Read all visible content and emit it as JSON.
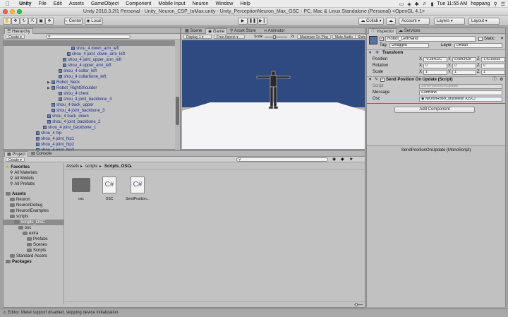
{
  "menubar": {
    "app_name": "Unity",
    "items": [
      "File",
      "Edit",
      "Assets",
      "GameObject",
      "Component",
      "Mobile Input",
      "Neuron",
      "Window",
      "Help"
    ],
    "clock": "Tue 11:55 AM",
    "user": "hoppang"
  },
  "window": {
    "title": "Unity 2018.3.2f1 Personal - Unity_Neuron_CSP_toMax.unity - Unity_PerceptionNeuron_Max_OSC - PC, Mac & Linux Standalone (Personal) <OpenGL 4.1>"
  },
  "toolbar": {
    "pivot_label": "Center",
    "space_label": "Local",
    "collab_label": "Collab",
    "account_label": "Account",
    "layers_label": "Layers",
    "layout_label": "Layout"
  },
  "hierarchy": {
    "tab_label": "Hierarchy",
    "create_label": "Create",
    "items": [
      {
        "label": "shou_4 down_arm_left"
      },
      {
        "label": "shou_4 joint_down_arm_left"
      },
      {
        "label": "shou_4 joint_upper_arm_left"
      },
      {
        "label": "shou_4 upper_arm_left"
      },
      {
        "label": "shou_4 collar_left"
      },
      {
        "label": "shou_4 collarbone_left"
      },
      {
        "label": "Robot_Neck"
      },
      {
        "label": "Robot_RightShoulder"
      },
      {
        "label": "shou_4 chest"
      },
      {
        "label": "shou_4 joint_backbone_4"
      },
      {
        "label": "shou_4 back_upper"
      },
      {
        "label": "shou_4 joint_backbone_3"
      },
      {
        "label": "shou_4 back_down"
      },
      {
        "label": "shou_4 joint_backbone_2"
      },
      {
        "label": "shou_4 joint_backbone_1"
      },
      {
        "label": "shou_4 hip"
      },
      {
        "label": "shou_4 joint_hip1"
      },
      {
        "label": "shou_4 joint_hip2"
      },
      {
        "label": "shou_4 joint_hip3"
      }
    ]
  },
  "scene_view": {
    "tabs": [
      "Scene",
      "Game",
      "Asset Store",
      "Animator"
    ],
    "display_label": "Display 1",
    "aspect_label": "Free Aspect",
    "scale_label": "Scale",
    "scale_value": "2x",
    "maximize_label": "Maximize On Play",
    "mute_label": "Mute Audio",
    "stats_label": "Stats"
  },
  "project": {
    "tabs": [
      "Project",
      "Console"
    ],
    "create_label": "Create",
    "breadcrumb": [
      "Assets",
      "scripts",
      "Scripts_OSC"
    ],
    "tree": [
      {
        "label": "Favorites",
        "level": 0,
        "bold": true,
        "icon": "star"
      },
      {
        "label": "All Materials",
        "level": 1,
        "icon": "search"
      },
      {
        "label": "All Models",
        "level": 1,
        "icon": "search"
      },
      {
        "label": "All Prefabs",
        "level": 1,
        "icon": "search"
      },
      {
        "label": "Assets",
        "level": 0,
        "bold": true,
        "icon": "folder"
      },
      {
        "label": "Neuron",
        "level": 1,
        "icon": "folder"
      },
      {
        "label": "NeuronDebug",
        "level": 1,
        "icon": "folder"
      },
      {
        "label": "NeuronExamples",
        "level": 1,
        "icon": "folder"
      },
      {
        "label": "scripts",
        "level": 1,
        "icon": "folder"
      },
      {
        "label": "Scripts_OSC",
        "level": 2,
        "icon": "folder",
        "selected": true
      },
      {
        "label": "osc",
        "level": 3,
        "icon": "folder"
      },
      {
        "label": "extra",
        "level": 4,
        "icon": "folder"
      },
      {
        "label": "Prefabs",
        "level": 5,
        "icon": "folder"
      },
      {
        "label": "Scenes",
        "level": 5,
        "icon": "folder"
      },
      {
        "label": "Scripts",
        "level": 5,
        "icon": "folder"
      },
      {
        "label": "Standard Assets",
        "level": 1,
        "icon": "folder"
      },
      {
        "label": "Packages",
        "level": 0,
        "bold": true,
        "icon": "folder"
      }
    ],
    "assets": [
      {
        "label": "osc",
        "kind": "folder"
      },
      {
        "label": "OSC",
        "kind": "script"
      },
      {
        "label": "SendPosition...",
        "kind": "script"
      }
    ],
    "script_icon_text": "C#"
  },
  "inspector": {
    "tabs": [
      "Inspector",
      "Services"
    ],
    "object_name": "Robot_LeftHand",
    "static_label": "Static",
    "tag_label": "Tag",
    "tag_value": "Untagged",
    "layer_label": "Layer",
    "layer_value": "Default",
    "transform": {
      "header": "Transform",
      "position_label": "Position",
      "rotation_label": "Rotation",
      "scale_label": "Scale",
      "x_label": "X",
      "y_label": "Y",
      "z_label": "Z",
      "position": [
        "-0.28402C",
        "5.684342e",
        "1.42108Se"
      ],
      "rotation": [
        "0",
        "0",
        "0"
      ],
      "scale": [
        "1",
        "1",
        "1"
      ]
    },
    "component": {
      "header": "Send Position On Update (Script)",
      "script_label": "Script",
      "script_value": "SendPositionOnUpdate",
      "message_label": "Message",
      "message_value": "/LeftHand",
      "osc_label": "Osc",
      "osc_value": "NeuronRobot_MultiMesh (OSC)"
    },
    "add_component_label": "Add Component",
    "preview_label": "SendPositionOnUpdate (MonoScript)"
  },
  "status": {
    "message": "Editor: Metal support disabled, skipping device initialization"
  },
  "colors": {
    "sky": "#2f4a80",
    "ground": "#f4f4f6",
    "selection": "#3a72d8",
    "hierarchy_text": "#1a2a8a"
  }
}
